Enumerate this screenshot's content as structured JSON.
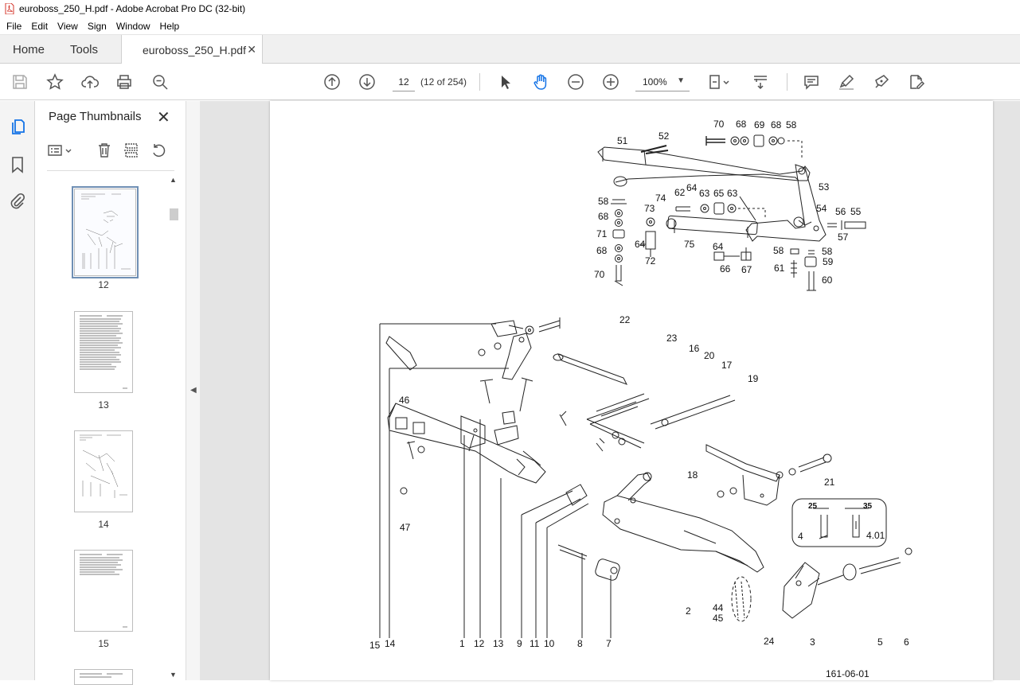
{
  "window": {
    "title": "euroboss_250_H.pdf - Adobe Acrobat Pro DC (32-bit)"
  },
  "menu": [
    "File",
    "Edit",
    "View",
    "Sign",
    "Window",
    "Help"
  ],
  "tabs": {
    "home": "Home",
    "tools": "Tools",
    "document": "euroboss_250_H.pdf"
  },
  "toolbar": {
    "page_current": "12",
    "page_of": "(12 of 254)",
    "zoom": "100%"
  },
  "thumbnails_panel": {
    "title": "Page Thumbnails",
    "pages": [
      "12",
      "13",
      "14",
      "15"
    ],
    "selected": "12"
  },
  "drawing": {
    "top_labels": [
      "70",
      "68",
      "69",
      "68",
      "58",
      "51",
      "52",
      "53",
      "74",
      "62",
      "64",
      "63",
      "65",
      "63",
      "58",
      "68",
      "73",
      "71",
      "64",
      "75",
      "54",
      "56",
      "55",
      "57",
      "64",
      "58",
      "58",
      "59",
      "68",
      "72",
      "66",
      "67",
      "61",
      "60",
      "70"
    ],
    "bottom_labels": [
      "22",
      "23",
      "16",
      "20",
      "17",
      "19",
      "46",
      "18",
      "21",
      "47",
      "4",
      "4.01",
      "25",
      "35",
      "44",
      "45",
      "2",
      "15",
      "14",
      "1",
      "12",
      "13",
      "9",
      "11",
      "10",
      "8",
      "7",
      "24",
      "3",
      "5",
      "6"
    ],
    "figure_code": "161-06-01"
  },
  "colors": {
    "accent": "#1473e6",
    "selection": "#6f8fb4",
    "viewer_bg": "#e4e4e4"
  }
}
